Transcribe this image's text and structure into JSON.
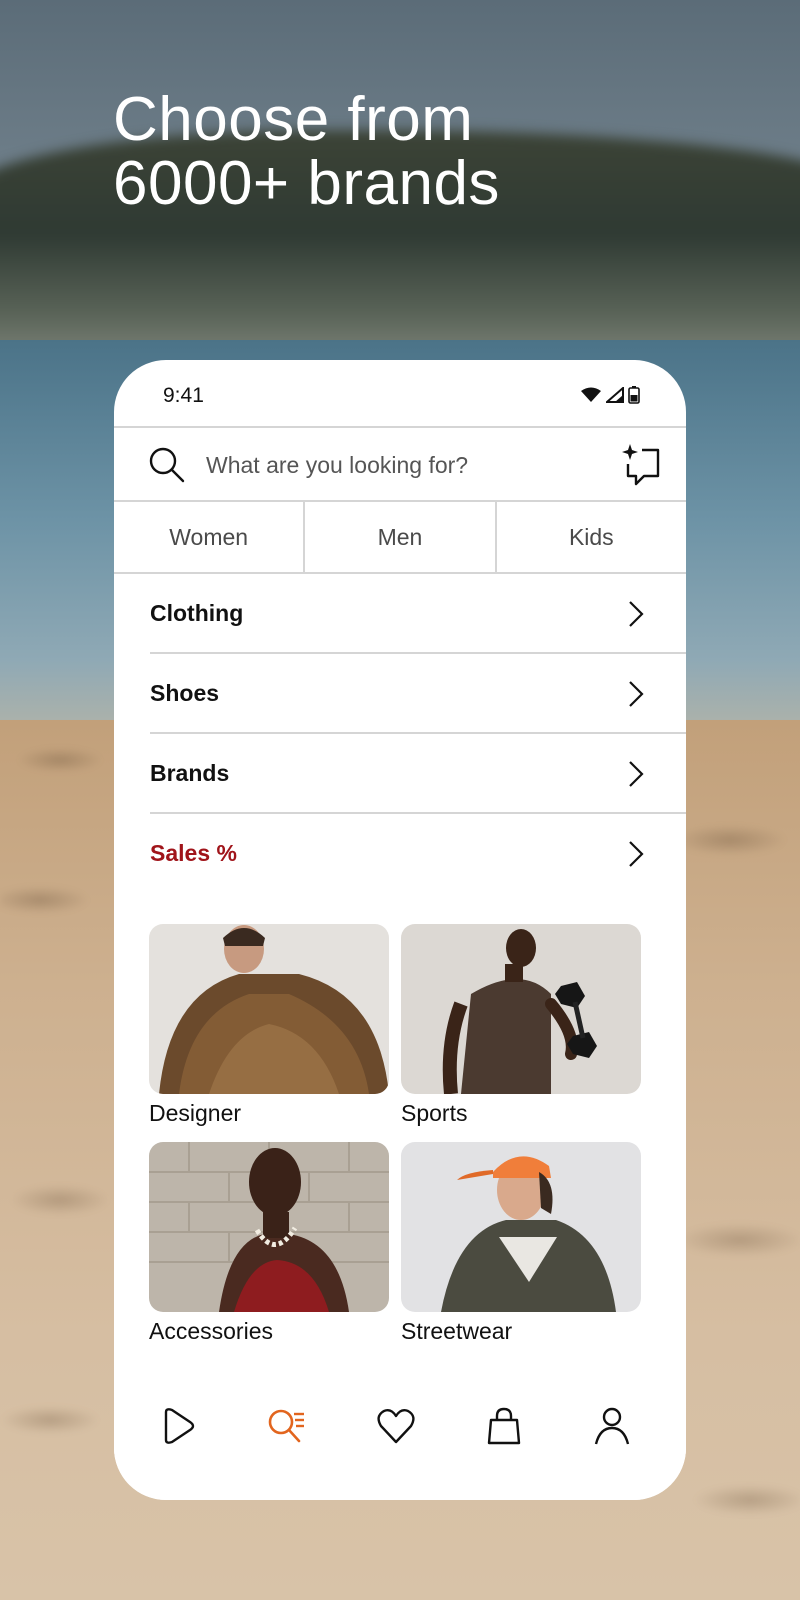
{
  "headline": {
    "line1": "Choose from",
    "line2": "6000+ brands"
  },
  "status_bar": {
    "time": "9:41"
  },
  "search": {
    "placeholder": "What are you looking for?"
  },
  "gender_tabs": [
    "Women",
    "Men",
    "Kids"
  ],
  "categories": [
    {
      "label": "Clothing"
    },
    {
      "label": "Shoes"
    },
    {
      "label": "Brands"
    },
    {
      "label": "Sales %",
      "color": "#a0141a"
    }
  ],
  "tiles": [
    {
      "label": "Designer",
      "image": "woman-in-fur-coat"
    },
    {
      "label": "Sports",
      "image": "man-lifting-dumbbell"
    },
    {
      "label": "Accessories",
      "image": "woman-with-pearl-necklace"
    },
    {
      "label": "Streetwear",
      "image": "man-in-orange-cap"
    }
  ],
  "bottom_nav": [
    {
      "name": "play-icon"
    },
    {
      "name": "search-list-icon",
      "active": true,
      "color": "#e2651e"
    },
    {
      "name": "heart-icon"
    },
    {
      "name": "shopping-bag-icon"
    },
    {
      "name": "profile-icon"
    }
  ]
}
